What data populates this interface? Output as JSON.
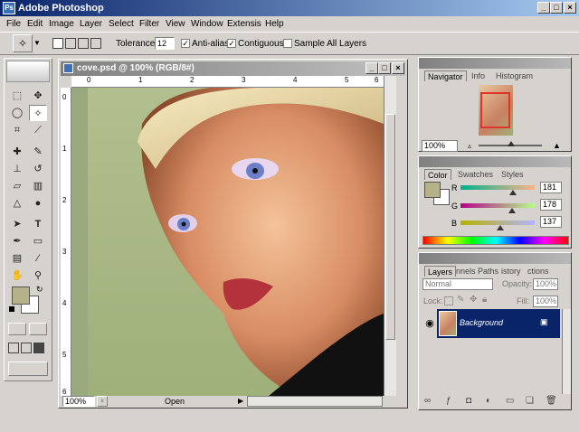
{
  "app": {
    "title": "Adobe Photoshop"
  },
  "menu": [
    "File",
    "Edit",
    "Image",
    "Layer",
    "Select",
    "Filter",
    "View",
    "Window",
    "Extensis",
    "Help"
  ],
  "options": {
    "tolerance_label": "Tolerance:",
    "tolerance_value": "12",
    "anti_alias": "Anti-alias",
    "contiguous": "Contiguous",
    "sample_all": "Sample All Layers"
  },
  "document": {
    "title": "cove.psd @ 100% (RGB/8#)",
    "zoom": "100%",
    "status": "Open",
    "ruler_h": [
      "0",
      "1",
      "2",
      "3",
      "4",
      "5",
      "6"
    ],
    "ruler_v": [
      "0",
      "1",
      "2",
      "3",
      "4",
      "5",
      "6"
    ]
  },
  "navigator": {
    "tabs": [
      "Navigator",
      "Info",
      "Histogram"
    ],
    "zoom": "100%"
  },
  "color": {
    "tabs": [
      "Color",
      "Swatches",
      "Styles"
    ],
    "r_label": "R",
    "g_label": "G",
    "b_label": "B",
    "r": "181",
    "g": "178",
    "b": "137",
    "r_frac": 0.71,
    "g_frac": 0.7,
    "b_frac": 0.54,
    "fg": "#b5b289"
  },
  "layers": {
    "tabs": [
      "Layers",
      "Channels",
      "Paths",
      "History",
      "Actions"
    ],
    "tab_visible": [
      "Layers",
      "nnels",
      "Paths",
      "istory",
      "ctions"
    ],
    "mode": "Normal",
    "opacity_label": "Opacity:",
    "opacity": "100%",
    "lock_label": "Lock:",
    "fill_label": "Fill:",
    "fill": "100%",
    "layer_name": "Background"
  }
}
